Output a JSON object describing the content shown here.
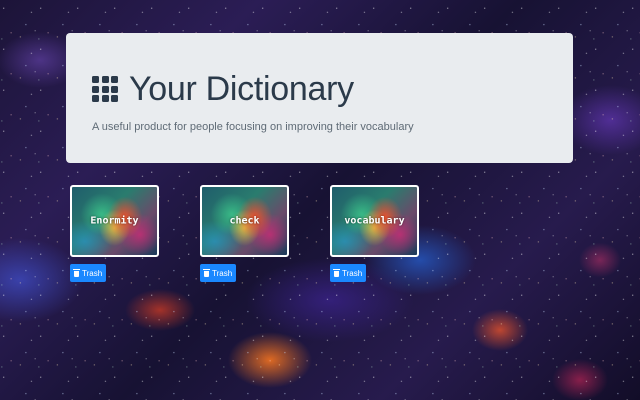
{
  "header": {
    "icon": "th-grid-icon",
    "title": "Your Dictionary",
    "subtitle": "A useful product for people focusing on improving their vocabulary"
  },
  "cards": [
    {
      "word": "Enormity",
      "button_label": "Trash",
      "button_icon": "trash-icon"
    },
    {
      "word": "check",
      "button_label": "Trash",
      "button_icon": "trash-icon"
    },
    {
      "word": "vocabulary",
      "button_label": "Trash",
      "button_icon": "trash-icon"
    }
  ],
  "colors": {
    "jumbotron_bg": "#e9ecef",
    "title": "#2b3a4a",
    "button": "#1a88ff"
  }
}
